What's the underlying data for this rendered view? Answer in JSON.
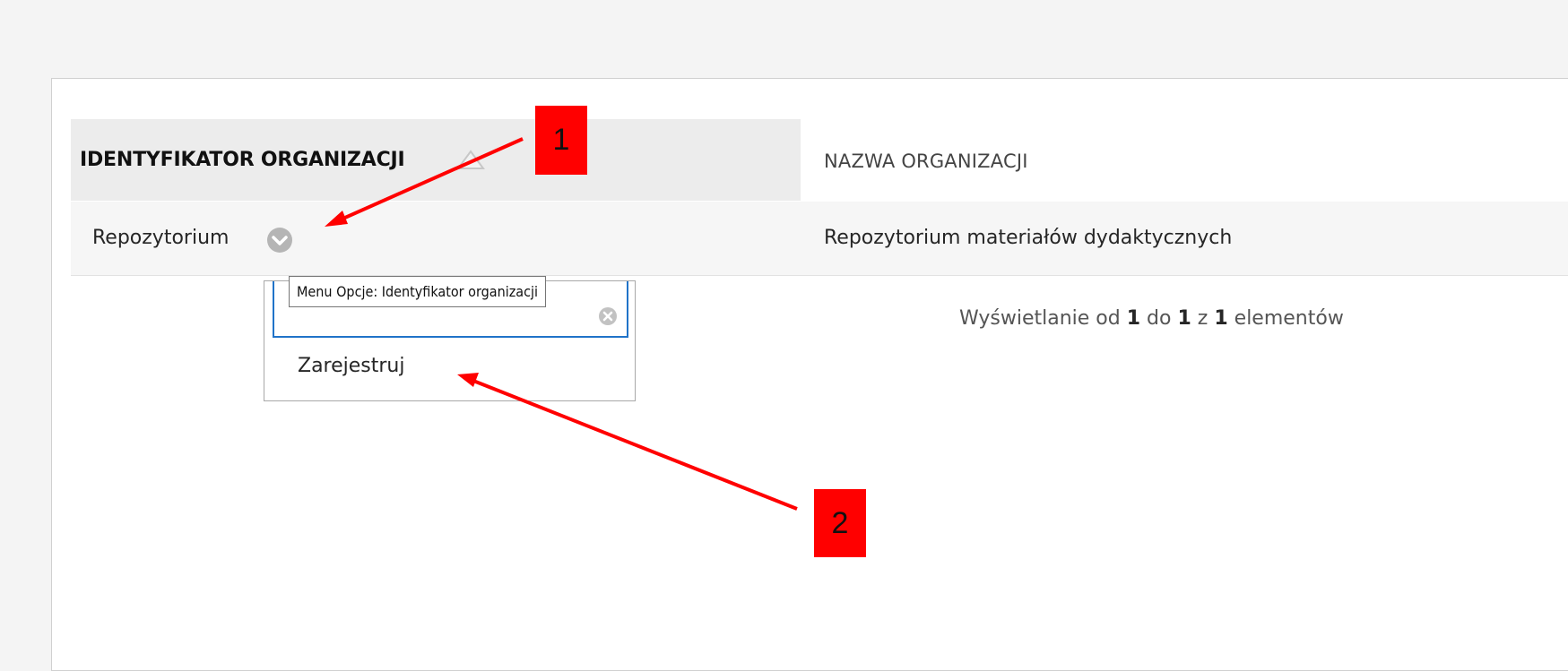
{
  "table": {
    "columns": [
      {
        "label": "IDENTYFIKATOR ORGANIZACJI",
        "sorted": "ascending"
      },
      {
        "label": "NAZWA ORGANIZACJI"
      }
    ],
    "rows": [
      {
        "id": "Repozytorium",
        "name": "Repozytorium materiałów dydaktycznych"
      }
    ]
  },
  "paging": {
    "prefix": "Wyświetlanie od",
    "from": "1",
    "to_word": "do",
    "to": "1",
    "of_word": "z",
    "total": "1",
    "suffix": "elementów"
  },
  "options_menu": {
    "tooltip": "Menu Opcje: Identyfikator organizacji",
    "search_value": "",
    "items": [
      {
        "label": "Zarejestruj"
      }
    ]
  },
  "annotations": [
    {
      "label": "1"
    },
    {
      "label": "2"
    }
  ],
  "colors": {
    "header_bg": "#ececec",
    "row_bg": "#f6f6f6",
    "focus_border": "#2073c9",
    "callout": "#ff0000",
    "icon_gray": "#b5b5b5"
  },
  "icons": {
    "sort": "triangle-up-outline-icon",
    "options": "chevron-down-circle-icon",
    "clear": "clear-circle-x-icon"
  }
}
